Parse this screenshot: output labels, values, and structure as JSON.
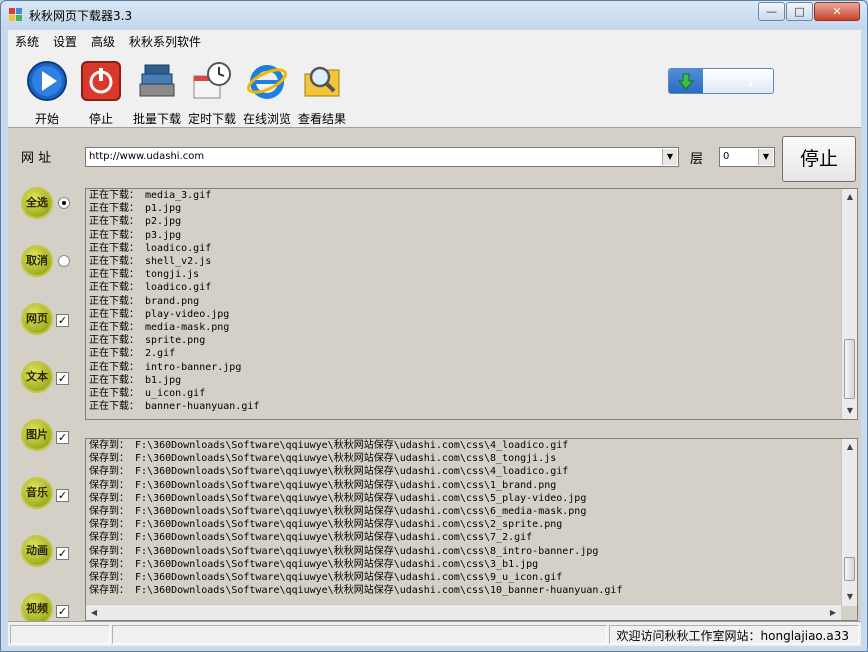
{
  "window": {
    "title": "秋秋网页下载器3.3",
    "minimize": "—",
    "maximize": "□",
    "close": "✕"
  },
  "menu": [
    "系统",
    "设置",
    "高级",
    "秋秋系列软件"
  ],
  "toolbar": {
    "start": "开始",
    "stop": "停止",
    "batch": "批量下载",
    "timed": "定时下载",
    "browse": "在线浏览",
    "results": "查看结果"
  },
  "progress": {
    "fraction": 0.33
  },
  "url": {
    "label": "网 址",
    "value": "http://www.udashi.com",
    "layer_label": "层",
    "layer_value": "0"
  },
  "stop_button": "停止",
  "side": {
    "select_all": "全选",
    "cancel": "取消",
    "webpage": "网页",
    "text": "文本",
    "image": "图片",
    "music": "音乐",
    "animation": "动画",
    "video": "视频"
  },
  "download_log": [
    "正在下载： media_3.gif",
    "正在下载： p1.jpg",
    "正在下载： p2.jpg",
    "正在下载： p3.jpg",
    "正在下载： loadico.gif",
    "正在下载： shell_v2.js",
    "正在下载： tongji.js",
    "正在下载： loadico.gif",
    "正在下载： brand.png",
    "正在下载： play-video.jpg",
    "正在下载： media-mask.png",
    "正在下载： sprite.png",
    "正在下载： 2.gif",
    "正在下载： intro-banner.jpg",
    "正在下载： b1.jpg",
    "正在下载： u_icon.gif",
    "正在下载： banner-huanyuan.gif"
  ],
  "save_log": [
    "保存到： F:\\360Downloads\\Software\\qqiuwye\\秋秋网站保存\\udashi.com\\css\\4_loadico.gif",
    "保存到： F:\\360Downloads\\Software\\qqiuwye\\秋秋网站保存\\udashi.com\\css\\8_tongji.js",
    "保存到： F:\\360Downloads\\Software\\qqiuwye\\秋秋网站保存\\udashi.com\\css\\4_loadico.gif",
    "保存到： F:\\360Downloads\\Software\\qqiuwye\\秋秋网站保存\\udashi.com\\css\\1_brand.png",
    "保存到： F:\\360Downloads\\Software\\qqiuwye\\秋秋网站保存\\udashi.com\\css\\5_play-video.jpg",
    "保存到： F:\\360Downloads\\Software\\qqiuwye\\秋秋网站保存\\udashi.com\\css\\6_media-mask.png",
    "保存到： F:\\360Downloads\\Software\\qqiuwye\\秋秋网站保存\\udashi.com\\css\\2_sprite.png",
    "保存到： F:\\360Downloads\\Software\\qqiuwye\\秋秋网站保存\\udashi.com\\css\\7_2.gif",
    "保存到： F:\\360Downloads\\Software\\qqiuwye\\秋秋网站保存\\udashi.com\\css\\8_intro-banner.jpg",
    "保存到： F:\\360Downloads\\Software\\qqiuwye\\秋秋网站保存\\udashi.com\\css\\3_b1.jpg",
    "保存到： F:\\360Downloads\\Software\\qqiuwye\\秋秋网站保存\\udashi.com\\css\\9_u_icon.gif",
    "保存到： F:\\360Downloads\\Software\\qqiuwye\\秋秋网站保存\\udashi.com\\css\\10_banner-huanyuan.gif"
  ],
  "status": "欢迎访问秋秋工作室网站：honglajiao.a33"
}
